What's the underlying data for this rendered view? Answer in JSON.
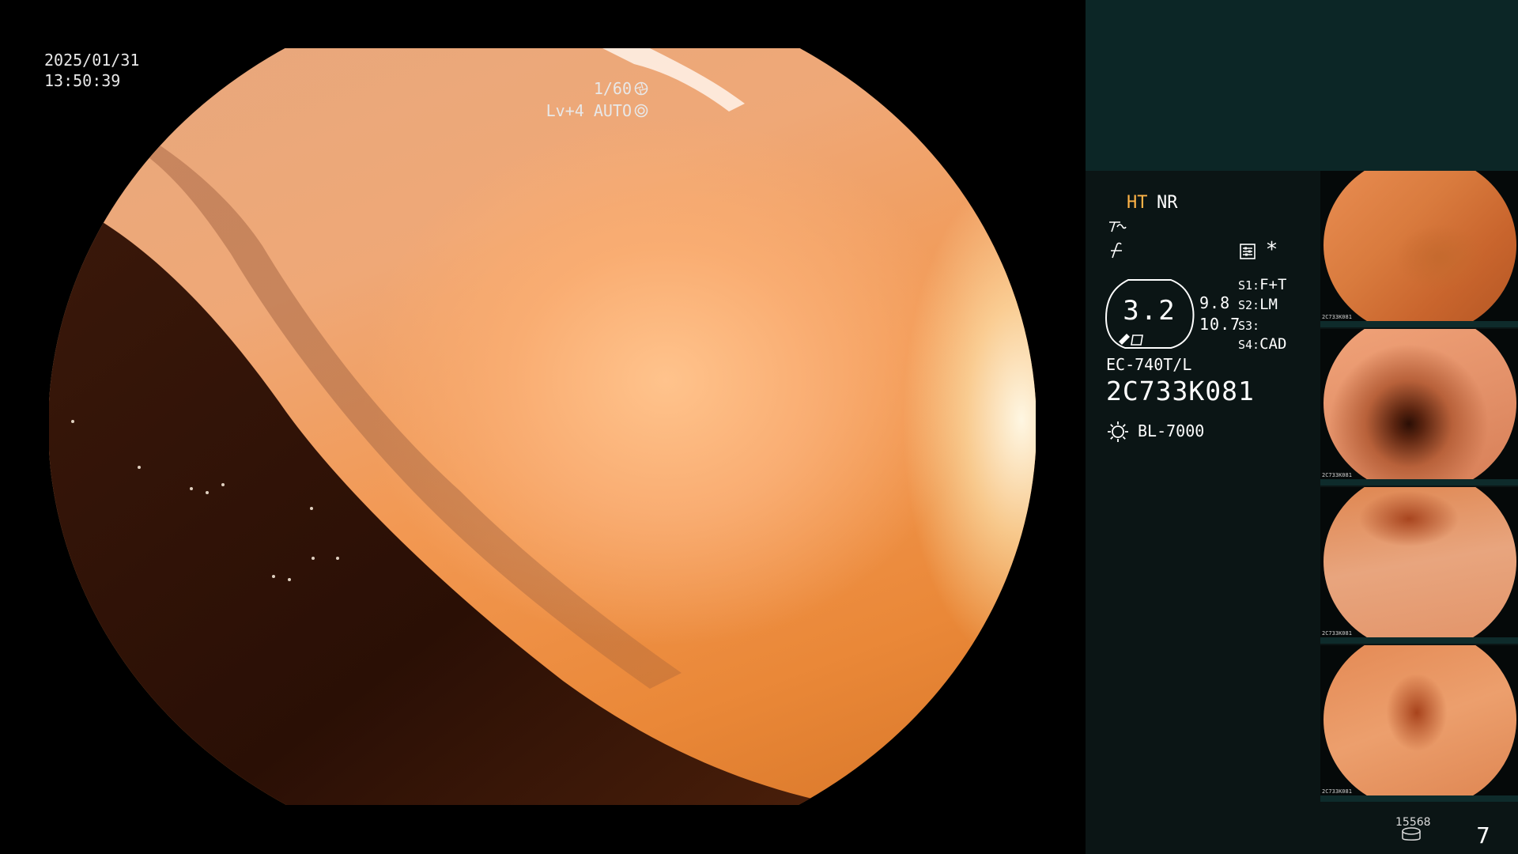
{
  "endoscope_view": {
    "date": "2025/01/31",
    "time": "13:50:39",
    "shutter": "1/60",
    "shutter_icon": "shutter-icon",
    "level": "Lv+4 AUTO",
    "iris_icon": "iris-icon"
  },
  "side_panel": {
    "modes": {
      "ht": "HT",
      "nr": "NR",
      "ht_color": "#ffb347"
    },
    "icons": {
      "wave1": "wave-curve-icon",
      "wave2": "wave-slash-icon",
      "settings": "settings-icon",
      "asterisk": "*"
    },
    "gauge": {
      "value": "3.2",
      "reading_1": "9.8",
      "reading_2": "10.7"
    },
    "switches": [
      {
        "key": "S1:",
        "value": "F+T"
      },
      {
        "key": "S2:",
        "value": "LM"
      },
      {
        "key": "S3:",
        "value": ""
      },
      {
        "key": "S4:",
        "value": "CAD"
      }
    ],
    "scope_model": "EC-740T/L",
    "scope_serial": "2C733K081",
    "light_source": "BL-7000",
    "light_icon": "light-source-icon"
  },
  "thumbnails": [
    {
      "label": "2C733K081"
    },
    {
      "label": "2C733K081"
    },
    {
      "label": "2C733K081"
    },
    {
      "label": "2C733K081"
    }
  ],
  "footer": {
    "record_count": "15568",
    "record_icon": "database-icon",
    "page_number": "7"
  },
  "colors": {
    "panel_bg": "#0b1515",
    "panel_top": "#0c2626",
    "accent": "#ffb347"
  }
}
